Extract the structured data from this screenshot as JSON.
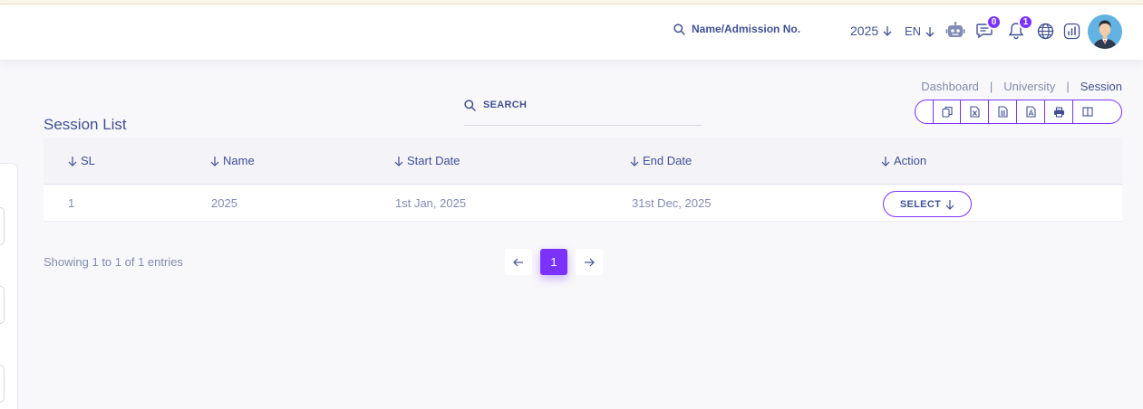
{
  "header": {
    "search_label": "Name/Admission No.",
    "year": "2025",
    "language": "EN",
    "messages_count": "0",
    "notifications_count": "1"
  },
  "breadcrumb": {
    "items": [
      "Dashboard",
      "University",
      "Session"
    ],
    "separator": "|"
  },
  "page": {
    "title": "Session List",
    "search_label": "SEARCH"
  },
  "export_buttons": [
    "copy-icon",
    "excel-icon",
    "csv-icon",
    "pdf-icon",
    "print-icon",
    "columns-icon"
  ],
  "table": {
    "columns": [
      "SL",
      "Name",
      "Start Date",
      "End Date",
      "Action"
    ],
    "rows": [
      {
        "sl": "1",
        "name": "2025",
        "start_date": "1st Jan, 2025",
        "end_date": "31st Dec, 2025",
        "action": "SELECT"
      }
    ]
  },
  "footer": {
    "entries_text": "Showing 1 to 1 of 1 entries",
    "current_page": "1"
  },
  "colors": {
    "accent": "#7c32ff",
    "text": "#415094",
    "muted": "#828bb2"
  }
}
